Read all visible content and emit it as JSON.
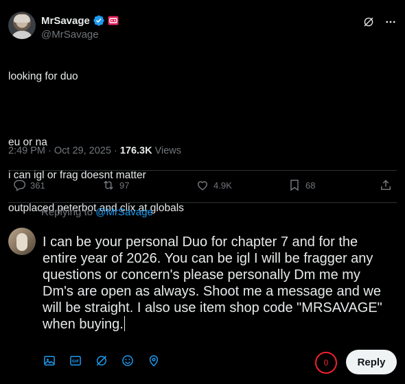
{
  "author": {
    "display_name": "MrSavage",
    "handle": "@MrSavage",
    "verified": true
  },
  "tweet": {
    "lines": [
      "looking for duo",
      "",
      "eu or na",
      "i can igl or frag doesnt matter",
      "outplaced peterbot and clix at globals"
    ],
    "time": "2:49 PM · Oct 29, 2025 · ",
    "views_count": "176.3K",
    "views_label": " Views"
  },
  "stats": {
    "replies": "361",
    "reposts": "97",
    "likes": "4.9K",
    "bookmarks": "68"
  },
  "reply": {
    "replying_to_prefix": "Replying to ",
    "replying_to_mention": "@MrSavage",
    "draft_text": "I can be your personal Duo for chapter 7 and for the entire year of 2026. You can be igl I will be fragger any questions or concern's please personally Dm me my Dm's are open as always. Shoot me a message and we will be straight. I also use item shop code \"MRSAVAGE\" when buying.",
    "remaining_chars": "0",
    "button_label": "Reply"
  },
  "colors": {
    "background": "#000000",
    "text_primary": "#e7e9ea",
    "text_secondary": "#71767b",
    "accent": "#1d9bf0",
    "error": "#f4212e"
  },
  "icons": {
    "toolbar": [
      "image-icon",
      "gif-icon",
      "grok-icon",
      "emoji-icon",
      "location-icon"
    ],
    "actions": [
      "reply-icon",
      "repost-icon",
      "like-icon",
      "bookmark-icon",
      "share-icon"
    ]
  }
}
